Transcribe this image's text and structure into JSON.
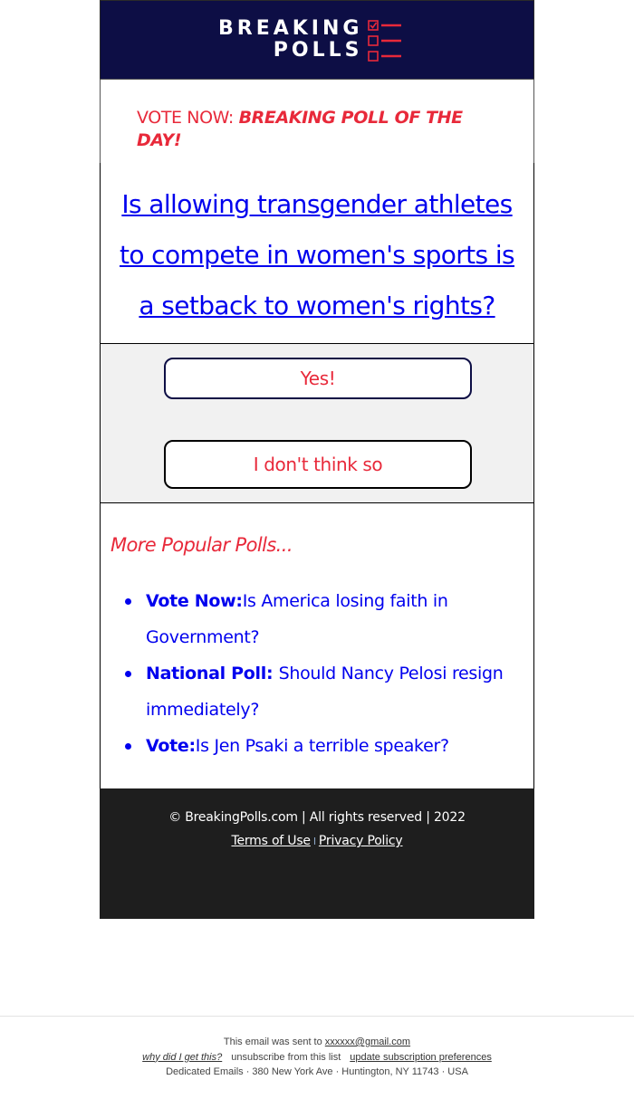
{
  "header": {
    "logo_line1": "BREAKING",
    "logo_line2": "POLLS",
    "logo_icon": "checklist-icon",
    "background_color": "#0d0e45",
    "accent_color": "#e8293a"
  },
  "vote_now": {
    "prefix": "VOTE NOW: ",
    "emphasis": "BREAKING POLL OF THE DAY!"
  },
  "question": {
    "text": "Is allowing transgender athletes to compete in women's sports is a setback to women's rights?"
  },
  "answers": [
    {
      "label": "Yes!"
    },
    {
      "label": "I don't think so"
    }
  ],
  "more_polls": {
    "title": "More Popular Polls...",
    "items": [
      {
        "prefix": "Vote Now:",
        "text": "Is America losing faith in Government?"
      },
      {
        "prefix": "National Poll: ",
        "text": "Should Nancy Pelosi resign immediately?"
      },
      {
        "prefix": "Vote:",
        "text": "Is Jen Psaki a terrible speaker?"
      }
    ]
  },
  "footer": {
    "copyright": "© BreakingPolls.com | All rights reserved | 2022",
    "terms": "Terms of Use",
    "separator": "I",
    "privacy": "Privacy Policy"
  },
  "email_footer": {
    "sent_to_prefix": "This email was sent to ",
    "email": "xxxxxx@gmail.com",
    "why": "why did I get this?",
    "unsubscribe": "unsubscribe from this list",
    "update_prefs": "update subscription preferences",
    "address": "Dedicated Emails · 380 New York Ave · Huntington, NY 11743 · USA"
  }
}
